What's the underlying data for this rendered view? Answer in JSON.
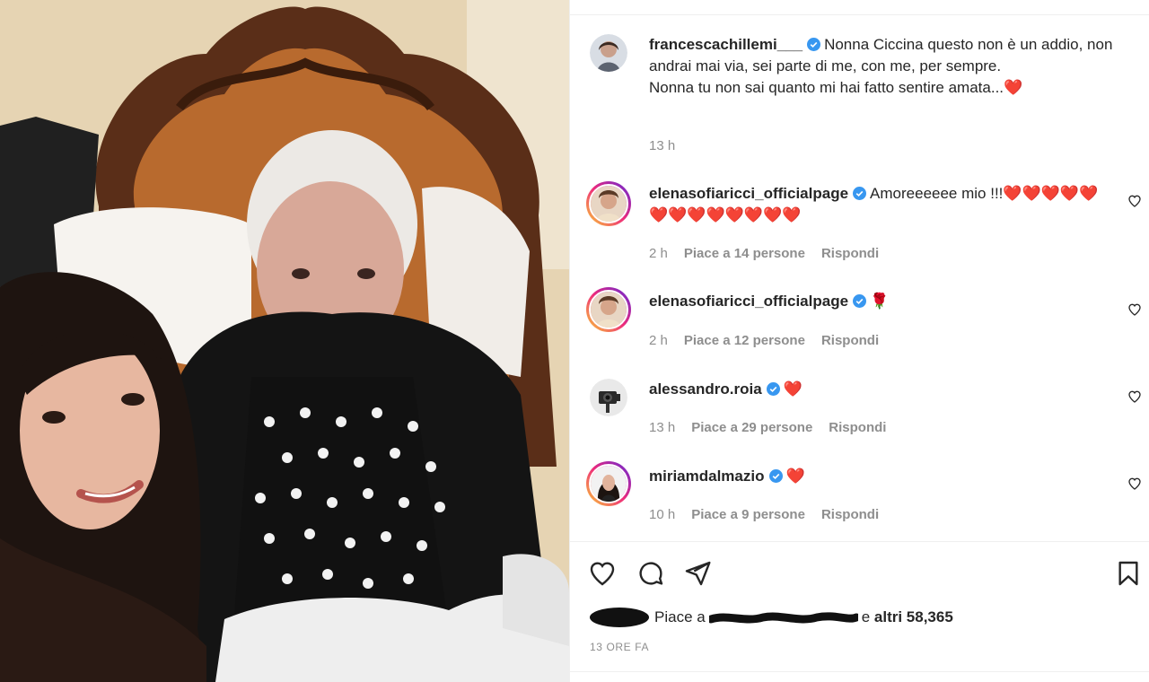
{
  "post": {
    "author": "francescachillemi___",
    "caption_line1": "Nonna Ciccina questo non è un addio, non andrai mai via, sei parte di me, con me, per sempre.",
    "caption_line2": "Nonna tu non sai quanto mi hai fatto sentire amata...",
    "caption_emoji": "❤️",
    "time": "13 h",
    "likes_prefix": "Piace a",
    "likes_suffix": "e altri 58,365",
    "timestamp": "13 ORE FA"
  },
  "comments": [
    {
      "user": "elenasofiaricci_officialpage",
      "text": "Amoreeeeee mio !!!",
      "emoji": "❤️❤️❤️❤️❤️❤️❤️❤️❤️❤️❤️❤️❤️",
      "time": "2 h",
      "likes": "Piace a 14 persone",
      "reply": "Rispondi"
    },
    {
      "user": "elenasofiaricci_officialpage",
      "text": "",
      "emoji": "🌹",
      "time": "2 h",
      "likes": "Piace a 12 persone",
      "reply": "Rispondi"
    },
    {
      "user": "alessandro.roia",
      "text": "",
      "emoji": "❤️",
      "time": "13 h",
      "likes": "Piace a 29 persone",
      "reply": "Rispondi"
    },
    {
      "user": "miriamdalmazio",
      "text": "",
      "emoji": "❤️",
      "time": "10 h",
      "likes": "Piace a 9 persone",
      "reply": "Rispondi"
    }
  ],
  "icons": {
    "like": "heart-icon",
    "comment": "comment-icon",
    "share": "paper-plane-icon",
    "save": "bookmark-icon",
    "verified": "verified-badge-icon"
  },
  "colors": {
    "verified": "#3897f0",
    "meta": "#8e8e8e",
    "text": "#262626",
    "heart": "#ed4956"
  }
}
